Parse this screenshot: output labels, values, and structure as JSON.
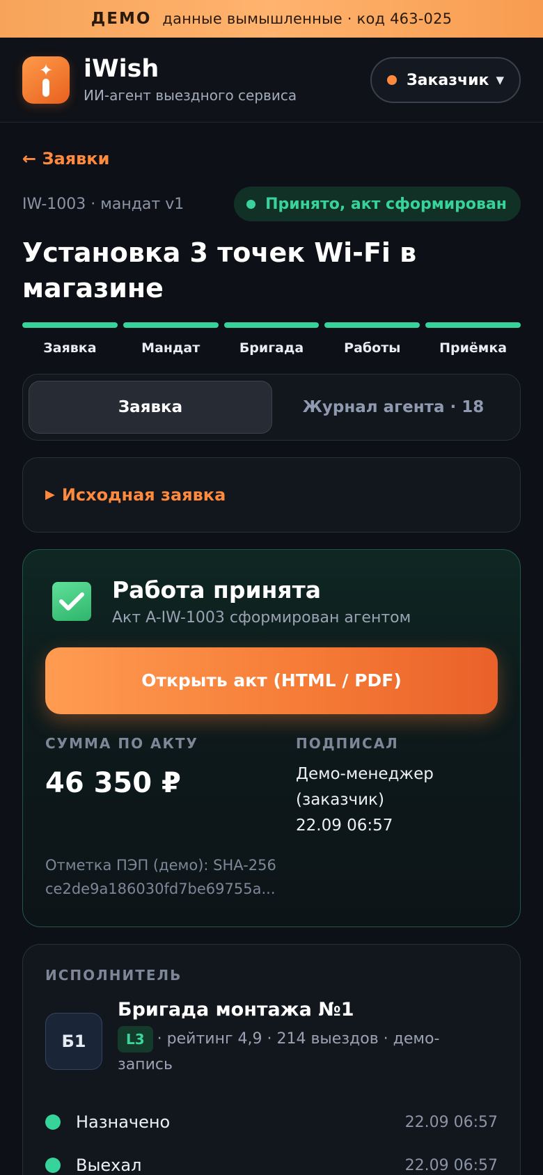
{
  "banner": {
    "demo_word": "ДЕМО",
    "text": "данные вымышленные · код 463-025"
  },
  "header": {
    "brand_name": "iWish",
    "brand_sub": "ИИ-агент выездного сервиса",
    "role": "Заказчик",
    "role_dot_color": "#ff8a3d"
  },
  "nav": {
    "back": "← Заявки"
  },
  "order": {
    "id_meta": "IW-1003 · мандат v1",
    "status": "Принято, акт сформирован",
    "status_color": "#38d39a",
    "title": "Установка 3 точек Wi-Fi в магазине"
  },
  "steps": [
    {
      "label": "Заявка",
      "done": true
    },
    {
      "label": "Мандат",
      "done": true
    },
    {
      "label": "Бригада",
      "done": true
    },
    {
      "label": "Работы",
      "done": true
    },
    {
      "label": "Приёмка",
      "done": true
    }
  ],
  "tabs": [
    {
      "label": "Заявка",
      "active": true
    },
    {
      "label": "Журнал агента · 18",
      "active": false
    }
  ],
  "source_request": {
    "label": "Исходная заявка"
  },
  "acceptance": {
    "title": "Работа принята",
    "subtitle": "Акт A-IW-1003 сформирован агентом",
    "open_button": "Открыть акт (HTML / PDF)",
    "sum_head": "СУММА ПО АКТУ",
    "sum_value": "46 350 ₽",
    "signed_head": "ПОДПИСАЛ",
    "signed_name": "Демо-менеджер (заказчик)",
    "signed_time": "22.09 06:57",
    "pep_line1": "Отметка ПЭП (демо): SHA-256",
    "pep_line2": "ce2de9a186030fd7be69755a..."
  },
  "executor": {
    "head": "ИСПОЛНИТЕЛЬ",
    "avatar": "Б1",
    "team_name": "Бригада монтажа №1",
    "level": "L3",
    "meta": "· рейтинг 4,9 · 214 выездов · демо-запись",
    "timeline": [
      {
        "label": "Назначено",
        "time": "22.09 06:57"
      },
      {
        "label": "Выехал",
        "time": "22.09 06:57"
      }
    ]
  }
}
